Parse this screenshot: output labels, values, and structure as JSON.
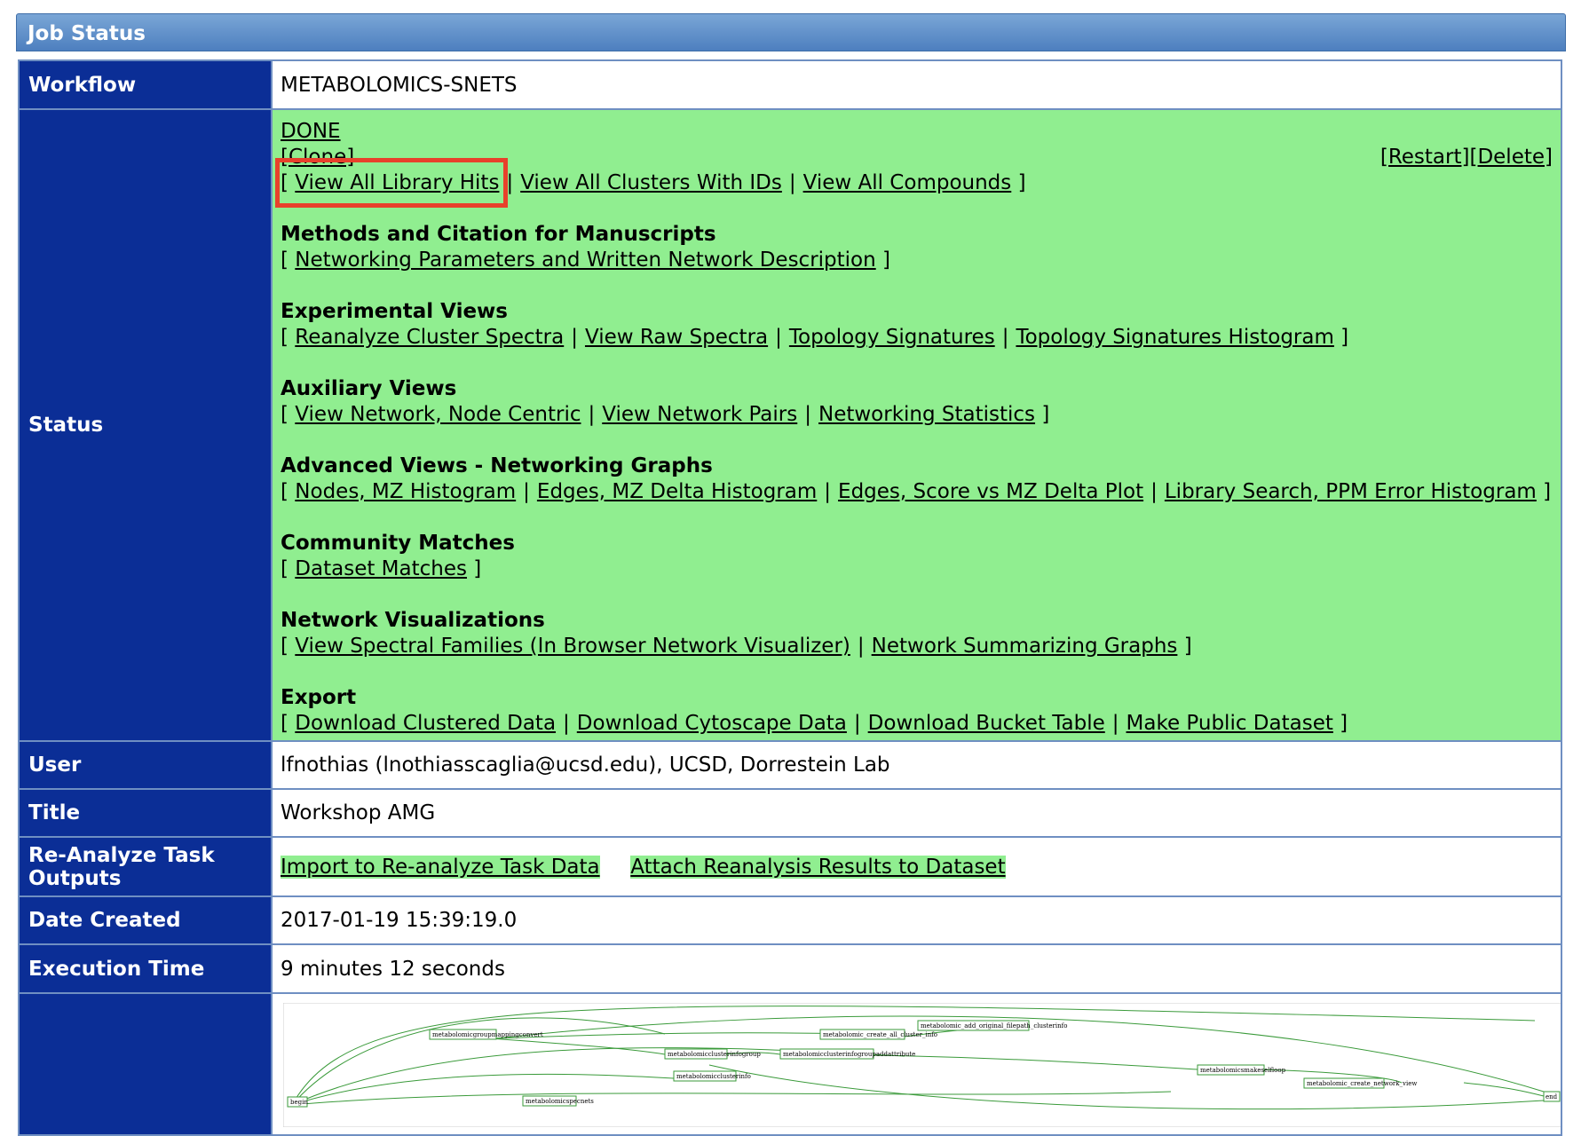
{
  "panel": {
    "title": "Job Status"
  },
  "labels": {
    "workflow": "Workflow",
    "status": "Status",
    "user": "User",
    "title": "Title",
    "reanalyze": "Re-Analyze Task Outputs",
    "date_created": "Date Created",
    "execution_time": "Execution Time"
  },
  "values": {
    "workflow": "METABOLOMICS-SNETS",
    "user": "lfnothias (lnothiasscaglia@ucsd.edu), UCSD, Dorrestein Lab",
    "title": "Workshop AMG",
    "date_created": "2017-01-19 15:39:19.0",
    "execution_time": "9 minutes 12 seconds"
  },
  "status": {
    "state": "DONE",
    "clone": "[Clone]",
    "restart": "[Restart]",
    "delete": "[Delete]",
    "top_links": [
      "View All Library Hits",
      "View All Clusters With IDs",
      "View All Compounds"
    ],
    "sections": [
      {
        "title": "Methods and Citation for Manuscripts",
        "links": [
          "Networking Parameters and Written Network Description"
        ]
      },
      {
        "title": "Experimental Views",
        "links": [
          "Reanalyze Cluster Spectra",
          "View Raw Spectra",
          "Topology Signatures",
          "Topology Signatures Histogram"
        ]
      },
      {
        "title": "Auxiliary Views",
        "links": [
          "View Network, Node Centric",
          "View Network Pairs",
          "Networking Statistics"
        ]
      },
      {
        "title": "Advanced Views - Networking Graphs",
        "links": [
          "Nodes, MZ Histogram",
          "Edges, MZ Delta Histogram",
          "Edges, Score vs MZ Delta Plot",
          "Library Search, PPM Error Histogram"
        ]
      },
      {
        "title": "Community Matches",
        "links": [
          "Dataset Matches"
        ]
      },
      {
        "title": "Network Visualizations",
        "links": [
          "View Spectral Families (In Browser Network Visualizer)",
          "Network Summarizing Graphs"
        ]
      },
      {
        "title": "Export",
        "links": [
          "Download Clustered Data",
          "Download Cytoscape Data",
          "Download Bucket Table",
          "Make Public Dataset"
        ]
      }
    ]
  },
  "reanalyze_links": [
    "Import to Re-analyze Task Data",
    "Attach Reanalysis Results to Dataset"
  ],
  "workflow_graph": {
    "nodes": [
      "metabolomicgroupmappingconvert",
      "metabolomic_create_all_cluster_info",
      "metabolomic_add_original_filepath_clusterinfo",
      "metabolomicclusterinfogroup",
      "metabolomicclusterinfogroupaddattribute",
      "metabolomicclusterinfo",
      "metabolomicsmakeselfloop",
      "metabolomic_create_network_view",
      "metabolomicspecnets",
      "begin",
      "end"
    ]
  },
  "colors": {
    "header": "#4d7fbf",
    "label_bg": "#0b2e96",
    "status_bg": "#90ee90",
    "highlight": "#e8412b",
    "graph_edge": "#3a9a3a"
  }
}
